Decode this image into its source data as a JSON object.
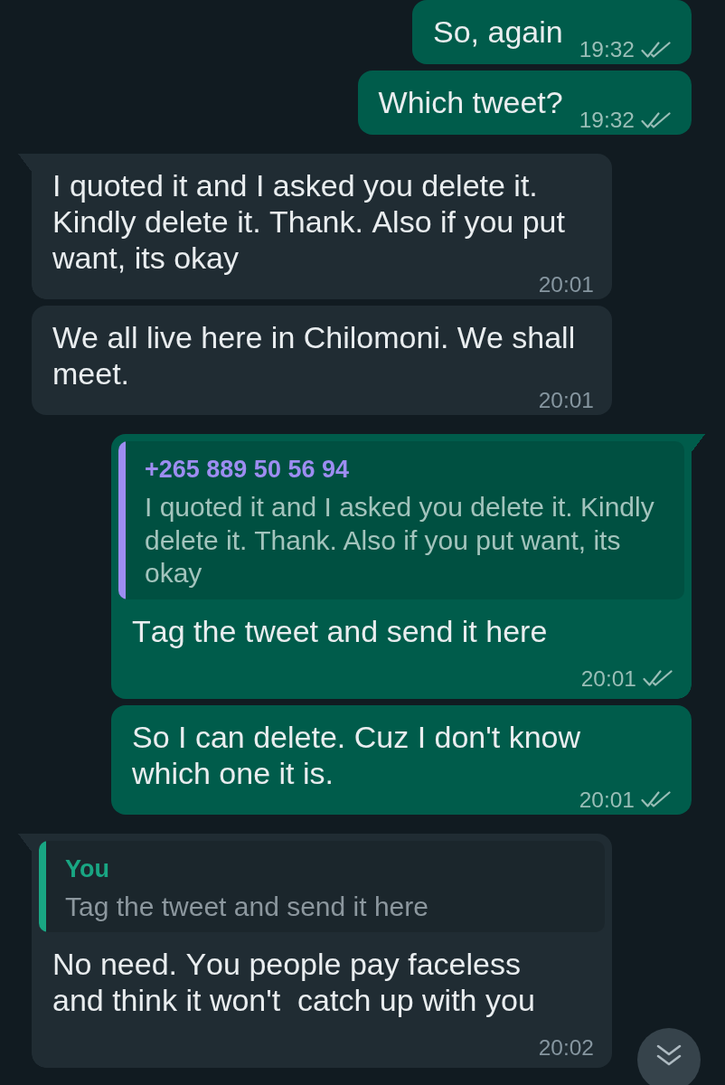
{
  "messages": [
    {
      "kind": "outgoing",
      "tail": false,
      "text": "So, again",
      "time": "19:32",
      "read": false
    },
    {
      "kind": "outgoing",
      "tail": false,
      "text": "Which tweet?",
      "time": "19:32",
      "read": false
    },
    {
      "kind": "incoming",
      "tail": true,
      "text": "I quoted it and I asked you delete it. Kindly delete it. Thank. Also if you put want, its okay",
      "time": "20:01"
    },
    {
      "kind": "incoming",
      "tail": false,
      "text": "We all live here in Chilomoni. We shall meet.",
      "time": "20:01"
    },
    {
      "kind": "outgoing",
      "tail": true,
      "quote": {
        "author": "+265 889 50 56 94",
        "color": "#9d8df1",
        "text": "I quoted it and I asked you delete it. Kindly delete it. Thank. Also if you put want, its okay"
      },
      "text": "Tag the tweet and send it here",
      "time": "20:01",
      "read": false
    },
    {
      "kind": "outgoing",
      "tail": false,
      "text": "So I can delete. Cuz I don't know which one it is.",
      "time": "20:01",
      "read": false
    },
    {
      "kind": "incoming",
      "tail": true,
      "quote": {
        "author": "You",
        "color": "#19a683",
        "text": "Tag the tweet and send it here"
      },
      "text": "No need. You people pay faceless and think it won't  catch up with you",
      "time": "20:02"
    }
  ]
}
